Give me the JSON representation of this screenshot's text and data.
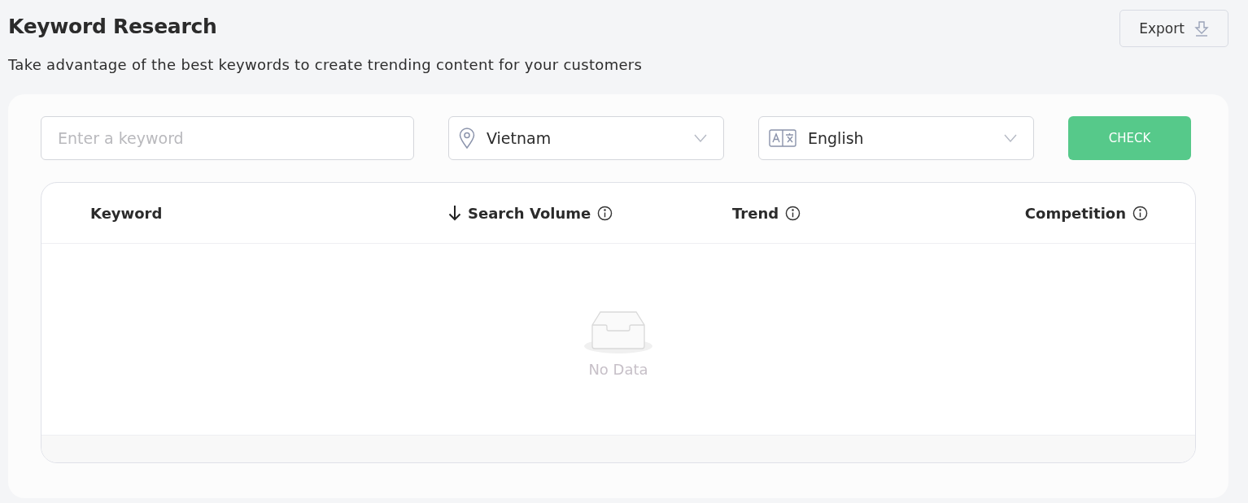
{
  "header": {
    "title": "Keyword Research",
    "subtitle": "Take advantage of the best keywords to create trending content for your customers",
    "export_button": "Export"
  },
  "filters": {
    "keyword": {
      "placeholder": "Enter a keyword"
    },
    "location": {
      "value": "Vietnam"
    },
    "language": {
      "value": "English"
    },
    "check_button": "CHECK"
  },
  "table": {
    "columns": [
      {
        "label": "Keyword",
        "sorted": false,
        "info": false
      },
      {
        "label": "Search Volume",
        "sorted": true,
        "info": true
      },
      {
        "label": "Trend",
        "sorted": false,
        "info": true
      },
      {
        "label": "Competition",
        "sorted": false,
        "info": true
      }
    ],
    "empty_text": "No Data"
  }
}
